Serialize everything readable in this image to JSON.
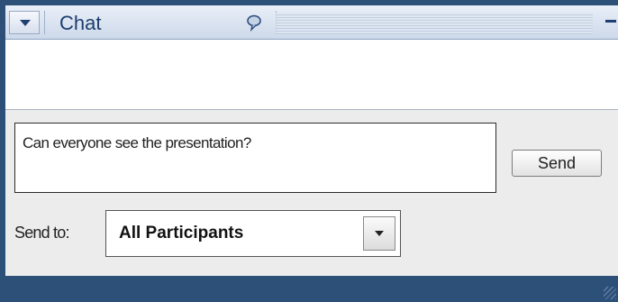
{
  "window": {
    "title": "Chat"
  },
  "icons": {
    "collapse": "triangle-down-icon",
    "bubble": "speech-bubble-icon",
    "minimize": "minimize-icon",
    "dropdown": "chevron-down-icon",
    "resize": "resize-grip-icon"
  },
  "compose": {
    "message_value": "Can everyone see the presentation?",
    "send_label": "Send",
    "send_to_label": "Send to:",
    "send_to_selected": "All Participants"
  },
  "colors": {
    "frame_blue": "#2d5079",
    "title_text": "#1e3e6e",
    "panel_bg": "#ececec"
  }
}
